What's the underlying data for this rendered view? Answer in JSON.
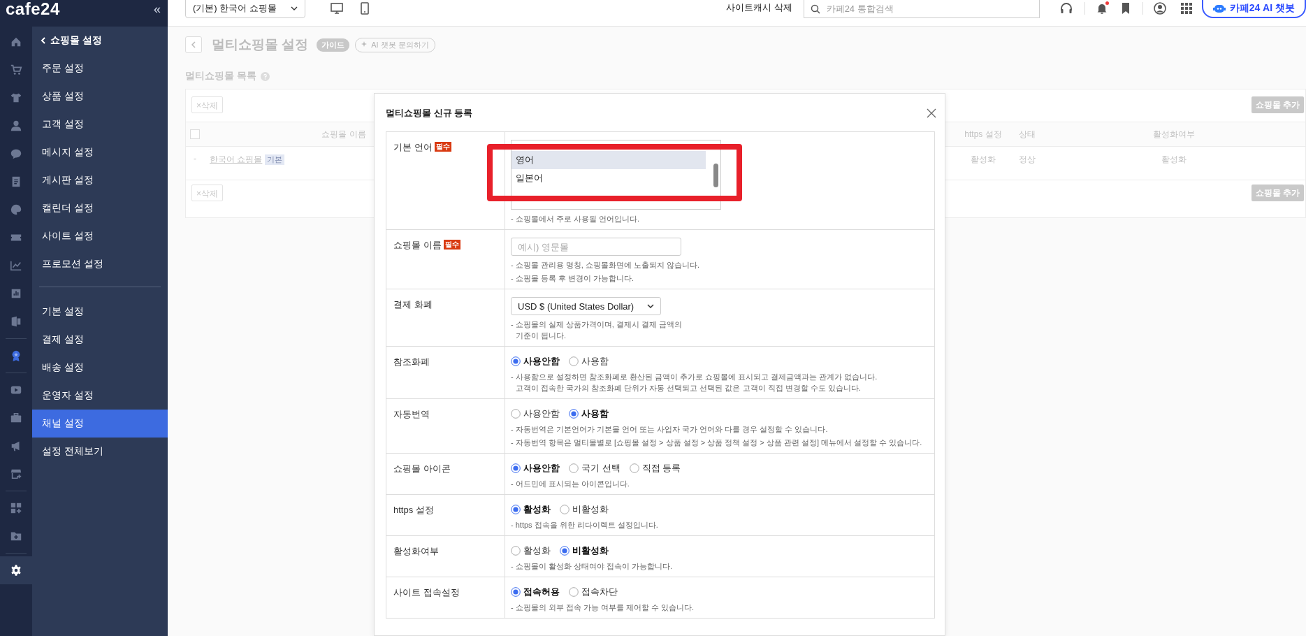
{
  "sidebar": {
    "logo": "cafe24",
    "collapse": "«",
    "rail": [
      {
        "kind": "icon",
        "selected": false
      },
      {
        "kind": "icon",
        "selected": false
      },
      {
        "kind": "icon",
        "selected": false
      },
      {
        "kind": "icon",
        "selected": false
      },
      {
        "kind": "icon",
        "selected": false
      },
      {
        "kind": "icon",
        "selected": false
      },
      {
        "kind": "icon",
        "selected": false
      },
      {
        "kind": "icon",
        "selected": false
      },
      {
        "kind": "icon",
        "selected": false
      },
      {
        "kind": "icon",
        "selected": false
      },
      {
        "kind": "icon",
        "selected": false
      },
      {
        "kind": "divider"
      },
      {
        "kind": "icon",
        "selected": false
      },
      {
        "kind": "divider"
      },
      {
        "kind": "icon",
        "selected": false
      },
      {
        "kind": "icon",
        "selected": false
      },
      {
        "kind": "icon",
        "selected": false
      },
      {
        "kind": "icon",
        "selected": false
      },
      {
        "kind": "divider"
      },
      {
        "kind": "icon",
        "selected": false
      },
      {
        "kind": "icon",
        "selected": false
      },
      {
        "kind": "divider"
      },
      {
        "kind": "icon",
        "selected": true
      }
    ],
    "menu_title": "쇼핑몰 설정",
    "groups": [
      [
        {
          "label": "주문 설정",
          "selected": false
        },
        {
          "label": "상품 설정",
          "selected": false
        },
        {
          "label": "고객 설정",
          "selected": false
        },
        {
          "label": "메시지 설정",
          "selected": false
        },
        {
          "label": "게시판 설정",
          "selected": false
        },
        {
          "label": "캘린더 설정",
          "selected": false
        },
        {
          "label": "사이트 설정",
          "selected": false
        },
        {
          "label": "프로모션 설정",
          "selected": false
        }
      ],
      [
        {
          "label": "기본 설정",
          "selected": false
        },
        {
          "label": "결제 설정",
          "selected": false
        },
        {
          "label": "배송 설정",
          "selected": false
        },
        {
          "label": "운영자 설정",
          "selected": false
        },
        {
          "label": "채널 설정",
          "selected": true
        },
        {
          "label": "설정 전체보기",
          "selected": false
        }
      ]
    ]
  },
  "topbar": {
    "shop_select": "(기본) 한국어 쇼핑몰",
    "cache_button": "사이트캐시 삭제",
    "search_placeholder": "카페24 통합검색",
    "notification": true,
    "ai_button": "카페24 AI 챗봇"
  },
  "page": {
    "title": "멀티쇼핑몰 설정",
    "guide_badge": "가이드",
    "ai_link": "AI 챗봇 문의하기",
    "section_title": "멀티쇼핑몰 목록",
    "toolbars": [
      {
        "delete_button": "×삭제",
        "add_button": "쇼핑몰 추가"
      },
      {
        "delete_button": "×삭제",
        "add_button": "쇼핑몰 추가"
      }
    ],
    "table": {
      "select_all_checked": false,
      "columns": [
        "쇼핑몰 이름",
        "https 설정",
        "상태",
        "활성화여부"
      ],
      "rows": [
        {
          "dash": "-",
          "name": "한국어 쇼핑몰",
          "badge": "기본",
          "https": "활성화",
          "status": "정상",
          "active": "활성화"
        }
      ]
    }
  },
  "modal": {
    "title": "멀티쇼핑몰 신규 등록",
    "rows": [
      {
        "label": "기본 언어",
        "required": "필수",
        "kind": "listbox",
        "options": [
          {
            "label": "영어",
            "selected": true
          },
          {
            "label": "일본어",
            "selected": false
          }
        ],
        "notes": [
          "- 쇼핑몰에서 주로 사용될 언어입니다."
        ]
      },
      {
        "label": "쇼핑몰 이름",
        "required": "필수",
        "kind": "text",
        "placeholder": "예시) 영문몰",
        "notes": [
          "- 쇼핑몰 관리용 명칭, 쇼핑몰화면에 노출되지 않습니다.",
          "- 쇼핑몰 등록 후 변경이 가능합니다."
        ]
      },
      {
        "label": "결제 화폐",
        "kind": "select",
        "value": "USD $ (United States Dollar)",
        "notes": [
          "- 쇼핑몰의 실제 상품가격이며, 결제시 결제 금액의\n기준이 됩니다."
        ]
      },
      {
        "label": "참조화폐",
        "kind": "radio",
        "options": [
          {
            "label": "사용안함",
            "selected": true
          },
          {
            "label": "사용함",
            "selected": false
          }
        ],
        "notes": [
          "- 사용함으로 설정하면 참조화폐로 환산된 금액이 추가로 쇼핑몰에 표시되고 결제금액과는 관계가 없습니다.\n고객이 접속한 국가의 참조화폐 단위가 자동 선택되고 선택된 값은 고객이 직접 변경할 수도 있습니다."
        ]
      },
      {
        "label": "자동번역",
        "kind": "radio",
        "options": [
          {
            "label": "사용안함",
            "selected": false
          },
          {
            "label": "사용함",
            "selected": true
          }
        ],
        "notes": [
          "- 자동번역은 기본언어가 기본몰 언어 또는 사업자 국가 언어와 다를 경우 설정할 수 있습니다.",
          "- 자동번역 항목은 멀티몰별로 [쇼핑몰 설정 > 상품 설정 > 상품 정책 설정 > 상품 관련 설정] 메뉴에서 설정할 수 있습니다."
        ]
      },
      {
        "label": "쇼핑몰 아이콘",
        "kind": "radio",
        "options": [
          {
            "label": "사용안함",
            "selected": true
          },
          {
            "label": "국기 선택",
            "selected": false
          },
          {
            "label": "직접 등록",
            "selected": false
          }
        ],
        "notes": [
          "- 어드민에 표시되는 아이콘입니다."
        ]
      },
      {
        "label": "https 설정",
        "kind": "radio",
        "options": [
          {
            "label": "활성화",
            "selected": true
          },
          {
            "label": "비활성화",
            "selected": false
          }
        ],
        "notes": [
          "- https 접속을 위한 리다이렉트 설정입니다."
        ]
      },
      {
        "label": "활성화여부",
        "kind": "radio",
        "options": [
          {
            "label": "활성화",
            "selected": false
          },
          {
            "label": "비활성화",
            "selected": true
          }
        ],
        "notes": [
          "- 쇼핑몰이 활성화 상태여야 접속이 가능합니다."
        ]
      },
      {
        "label": "사이트 접속설정",
        "kind": "radio",
        "options": [
          {
            "label": "접속허용",
            "selected": true
          },
          {
            "label": "접속차단",
            "selected": false
          }
        ],
        "notes": [
          "- 쇼핑몰의 외부 접속 가능 여부를 제어할 수 있습니다."
        ]
      }
    ]
  }
}
